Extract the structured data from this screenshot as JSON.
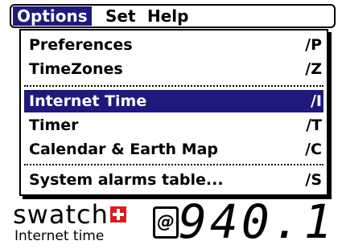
{
  "menubar": {
    "items": [
      "Options",
      "Set",
      "Help"
    ]
  },
  "menu": {
    "items": [
      {
        "label": "Preferences",
        "shortcut": "∕P"
      },
      {
        "label": "TimeZones",
        "shortcut": "∕Z"
      },
      {
        "label": "Internet Time",
        "shortcut": "∕I"
      },
      {
        "label": "Timer",
        "shortcut": "∕T"
      },
      {
        "label": "Calendar & Earth Map",
        "shortcut": "∕C"
      },
      {
        "label": "System alarms table...",
        "shortcut": "∕S"
      }
    ]
  },
  "footer": {
    "brand": "swatch",
    "subtitle": "Internet time",
    "at_symbol": "@",
    "beat_time": "940.1"
  },
  "colors": {
    "highlight": "#1d1a7c",
    "swiss_red": "#d81f1f"
  }
}
